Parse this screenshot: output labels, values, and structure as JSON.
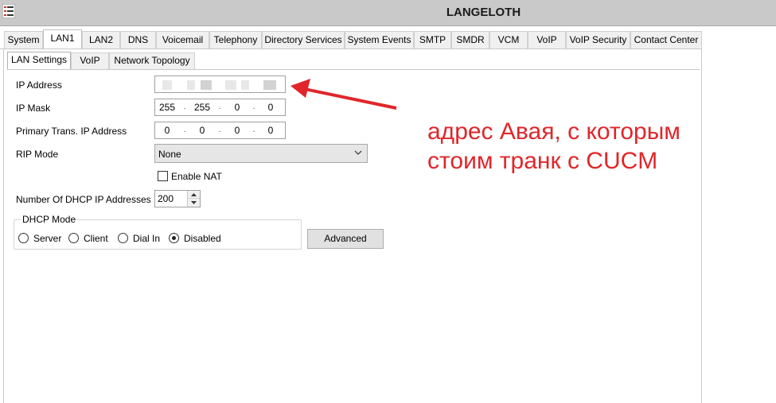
{
  "window": {
    "title": "LANGELOTH",
    "icon": "list-menu-icon"
  },
  "main_tabs": [
    {
      "label": "System",
      "active": false
    },
    {
      "label": "LAN1",
      "active": true
    },
    {
      "label": "LAN2",
      "active": false
    },
    {
      "label": "DNS",
      "active": false
    },
    {
      "label": "Voicemail",
      "active": false
    },
    {
      "label": "Telephony",
      "active": false
    },
    {
      "label": "Directory Services",
      "active": false
    },
    {
      "label": "System Events",
      "active": false
    },
    {
      "label": "SMTP",
      "active": false
    },
    {
      "label": "SMDR",
      "active": false
    },
    {
      "label": "VCM",
      "active": false
    },
    {
      "label": "VoIP",
      "active": false
    },
    {
      "label": "VoIP Security",
      "active": false
    },
    {
      "label": "Contact Center",
      "active": false
    }
  ],
  "sub_tabs": [
    {
      "label": "LAN Settings",
      "active": true
    },
    {
      "label": "VoIP",
      "active": false
    },
    {
      "label": "Network Topology",
      "active": false
    }
  ],
  "form": {
    "ip_address": {
      "label": "IP Address"
    },
    "ip_mask": {
      "label": "IP Mask",
      "octets": [
        "255",
        "255",
        "0",
        "0"
      ]
    },
    "primary_trans_ip": {
      "label": "Primary Trans. IP Address",
      "octets": [
        "0",
        "0",
        "0",
        "0"
      ]
    },
    "rip_mode": {
      "label": "RIP Mode",
      "value": "None"
    },
    "enable_nat": {
      "label": "Enable NAT",
      "checked": false
    },
    "dhcp_count": {
      "label": "Number Of DHCP IP Addresses",
      "value": "200"
    },
    "dhcp_mode": {
      "label": "DHCP Mode",
      "options": [
        {
          "label": "Server",
          "checked": false
        },
        {
          "label": "Client",
          "checked": false
        },
        {
          "label": "Dial In",
          "checked": false
        },
        {
          "label": "Disabled",
          "checked": true
        }
      ]
    },
    "advanced_button": "Advanced"
  },
  "annotation": {
    "line1": "адрес Авая, с которым",
    "line2": "стоим транк с CUCM",
    "color": "#e0262a"
  }
}
